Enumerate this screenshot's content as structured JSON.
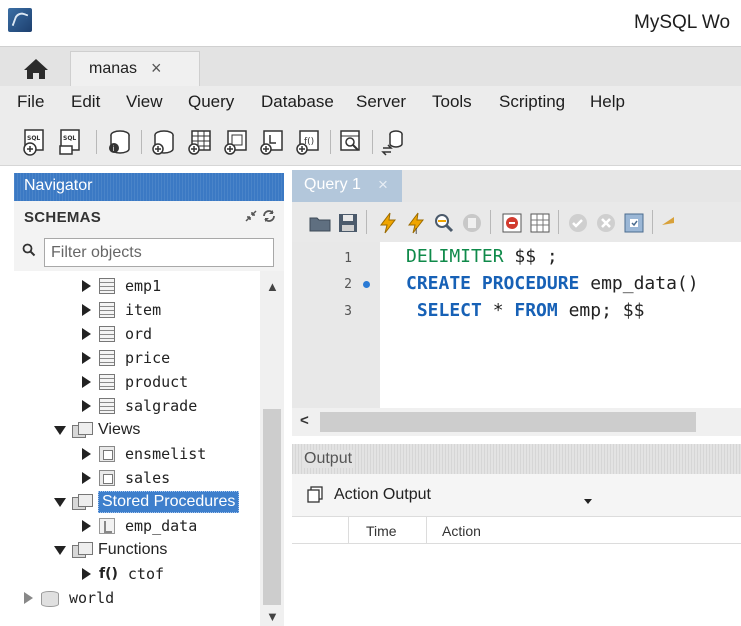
{
  "window": {
    "title": "MySQL Wo"
  },
  "tabs": {
    "connection": {
      "label": "manas",
      "close": "×"
    }
  },
  "menu": [
    "File",
    "Edit",
    "View",
    "Query",
    "Database",
    "Server",
    "Tools",
    "Scripting",
    "Help"
  ],
  "navigator": {
    "header": "Navigator",
    "schemas_label": "SCHEMAS",
    "filter_placeholder": "Filter objects",
    "tree": {
      "tables": [
        "emp1",
        "item",
        "ord",
        "price",
        "product",
        "salgrade"
      ],
      "views_label": "Views",
      "views": [
        "ensmelist",
        "sales"
      ],
      "procedures_label": "Stored Procedures",
      "procedures": [
        "emp_data"
      ],
      "functions_label": "Functions",
      "function_icon": "f()",
      "functions": [
        "ctof"
      ],
      "other_schema": "world"
    }
  },
  "query": {
    "tab_label": "Query 1",
    "tab_close": "×",
    "line_numbers": [
      "1",
      "2",
      "3"
    ],
    "lines": [
      [
        {
          "t": "DELIMITER",
          "k": "green"
        },
        {
          "t": " $$ ;",
          "k": "plain"
        }
      ],
      [
        {
          "t": "CREATE PROCEDURE",
          "k": "blue"
        },
        {
          "t": " emp_data()",
          "k": "plain"
        }
      ],
      [
        {
          "t": " SELECT",
          "k": "blue"
        },
        {
          "t": " * ",
          "k": "plain"
        },
        {
          "t": "FROM",
          "k": "blue"
        },
        {
          "t": " emp; $$",
          "k": "plain"
        }
      ]
    ]
  },
  "output": {
    "header": "Output",
    "selected": "Action Output",
    "columns": {
      "time": "Time",
      "action": "Action"
    }
  },
  "colors": {
    "accent": "#3b79c4",
    "keyword_blue": "#1761b6",
    "keyword_green": "#0f8a4a"
  }
}
